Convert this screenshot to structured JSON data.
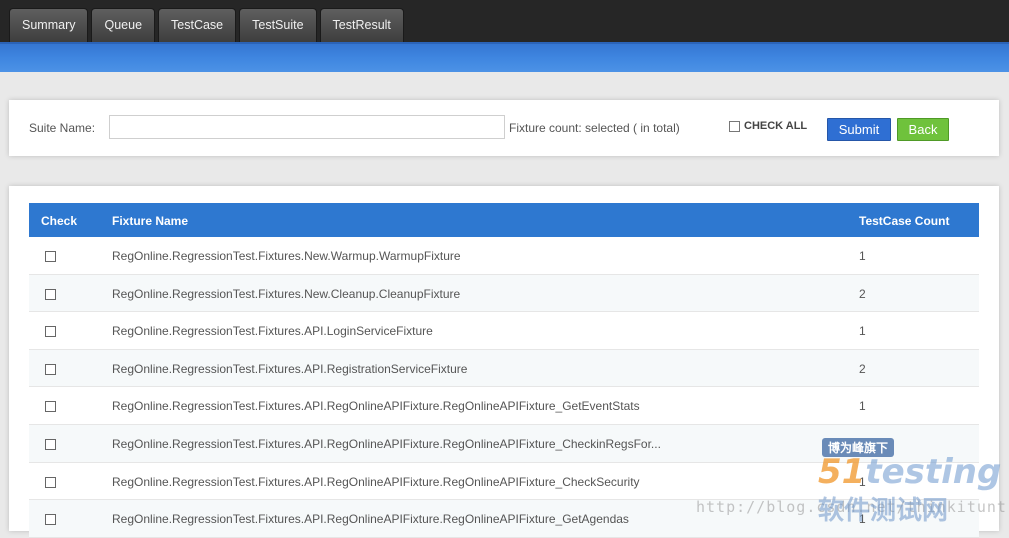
{
  "tabs": [
    {
      "label": "Summary"
    },
    {
      "label": "Queue"
    },
    {
      "label": "TestCase"
    },
    {
      "label": "TestSuite"
    },
    {
      "label": "TestResult"
    }
  ],
  "form": {
    "suite_name_label": "Suite Name:",
    "suite_name_value": "",
    "fixture_count_text": "Fixture count:  selected ( in total)",
    "check_all_label": "CHECK ALL",
    "submit_label": "Submit",
    "back_label": "Back"
  },
  "table": {
    "headers": [
      "Check",
      "Fixture Name",
      "TestCase Count"
    ],
    "rows": [
      {
        "name": "RegOnline.RegressionTest.Fixtures.New.Warmup.WarmupFixture",
        "count": "1"
      },
      {
        "name": "RegOnline.RegressionTest.Fixtures.New.Cleanup.CleanupFixture",
        "count": "2"
      },
      {
        "name": "RegOnline.RegressionTest.Fixtures.API.LoginServiceFixture",
        "count": "1"
      },
      {
        "name": "RegOnline.RegressionTest.Fixtures.API.RegistrationServiceFixture",
        "count": "2"
      },
      {
        "name": "RegOnline.RegressionTest.Fixtures.API.RegOnlineAPIFixture.RegOnlineAPIFixture_GetEventStats",
        "count": "1"
      },
      {
        "name": "RegOnline.RegressionTest.Fixtures.API.RegOnlineAPIFixture.RegOnlineAPIFixture_CheckinRegsFor...",
        "count": "1"
      },
      {
        "name": "RegOnline.RegressionTest.Fixtures.API.RegOnlineAPIFixture.RegOnlineAPIFixture_CheckSecurity",
        "count": "1"
      },
      {
        "name": "RegOnline.RegressionTest.Fixtures.API.RegOnlineAPIFixture.RegOnlineAPIFixture_GetAgendas",
        "count": "1"
      }
    ]
  },
  "watermark": {
    "badge": "博为峰旗下",
    "logo_num": "51",
    "logo_text": "testing",
    "cn": "软件测试网",
    "url": "http://blog.csdn.net/thinkitunt"
  },
  "colors": {
    "header_blue": "#2e78d0",
    "submit_blue": "#2f6fd3",
    "back_green": "#6fc23c"
  }
}
